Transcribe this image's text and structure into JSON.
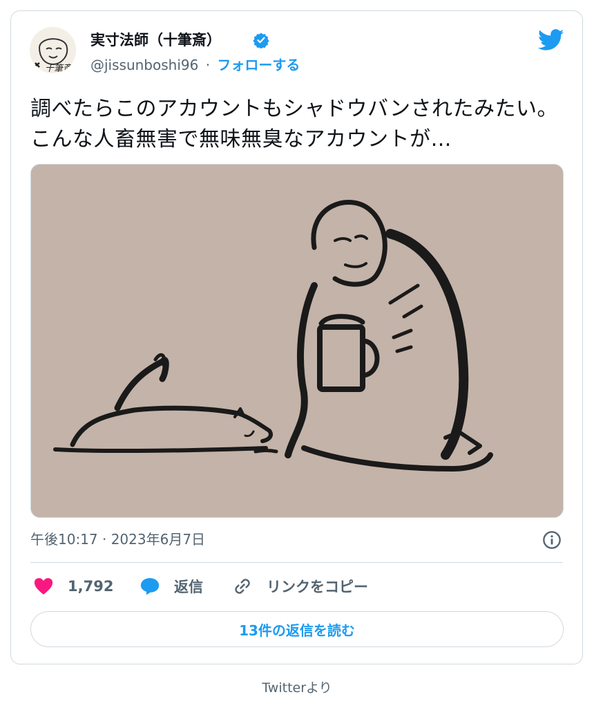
{
  "author": {
    "name": "実寸法師（十筆斎）",
    "handle": "@jissunboshi96",
    "separator": "·",
    "follow_label": "フォローする",
    "verified": true,
    "avatar_text": "十筆斎"
  },
  "tweet": {
    "text": "調べたらこのアカウントもシャドウバンされたみたい。こんな人畜無害で無味無臭なアカウントが…",
    "timestamp": "午後10:17 · 2023年6月7日"
  },
  "actions": {
    "like_count": "1,792",
    "reply_label": "返信",
    "copy_link_label": "リンクをコピー"
  },
  "read_replies_label": "13件の返信を読む",
  "source_label": "Twitterより",
  "colors": {
    "accent": "#1d9bf0",
    "like": "#f91880",
    "secondary_text": "#536471",
    "border": "#cfd9de",
    "media_bg": "#c4b3a8"
  },
  "icons": {
    "brand": "twitter-bird-icon",
    "verified": "verified-badge-icon",
    "info": "info-icon",
    "like": "heart-icon",
    "reply": "speech-bubble-icon",
    "copy": "link-icon"
  }
}
